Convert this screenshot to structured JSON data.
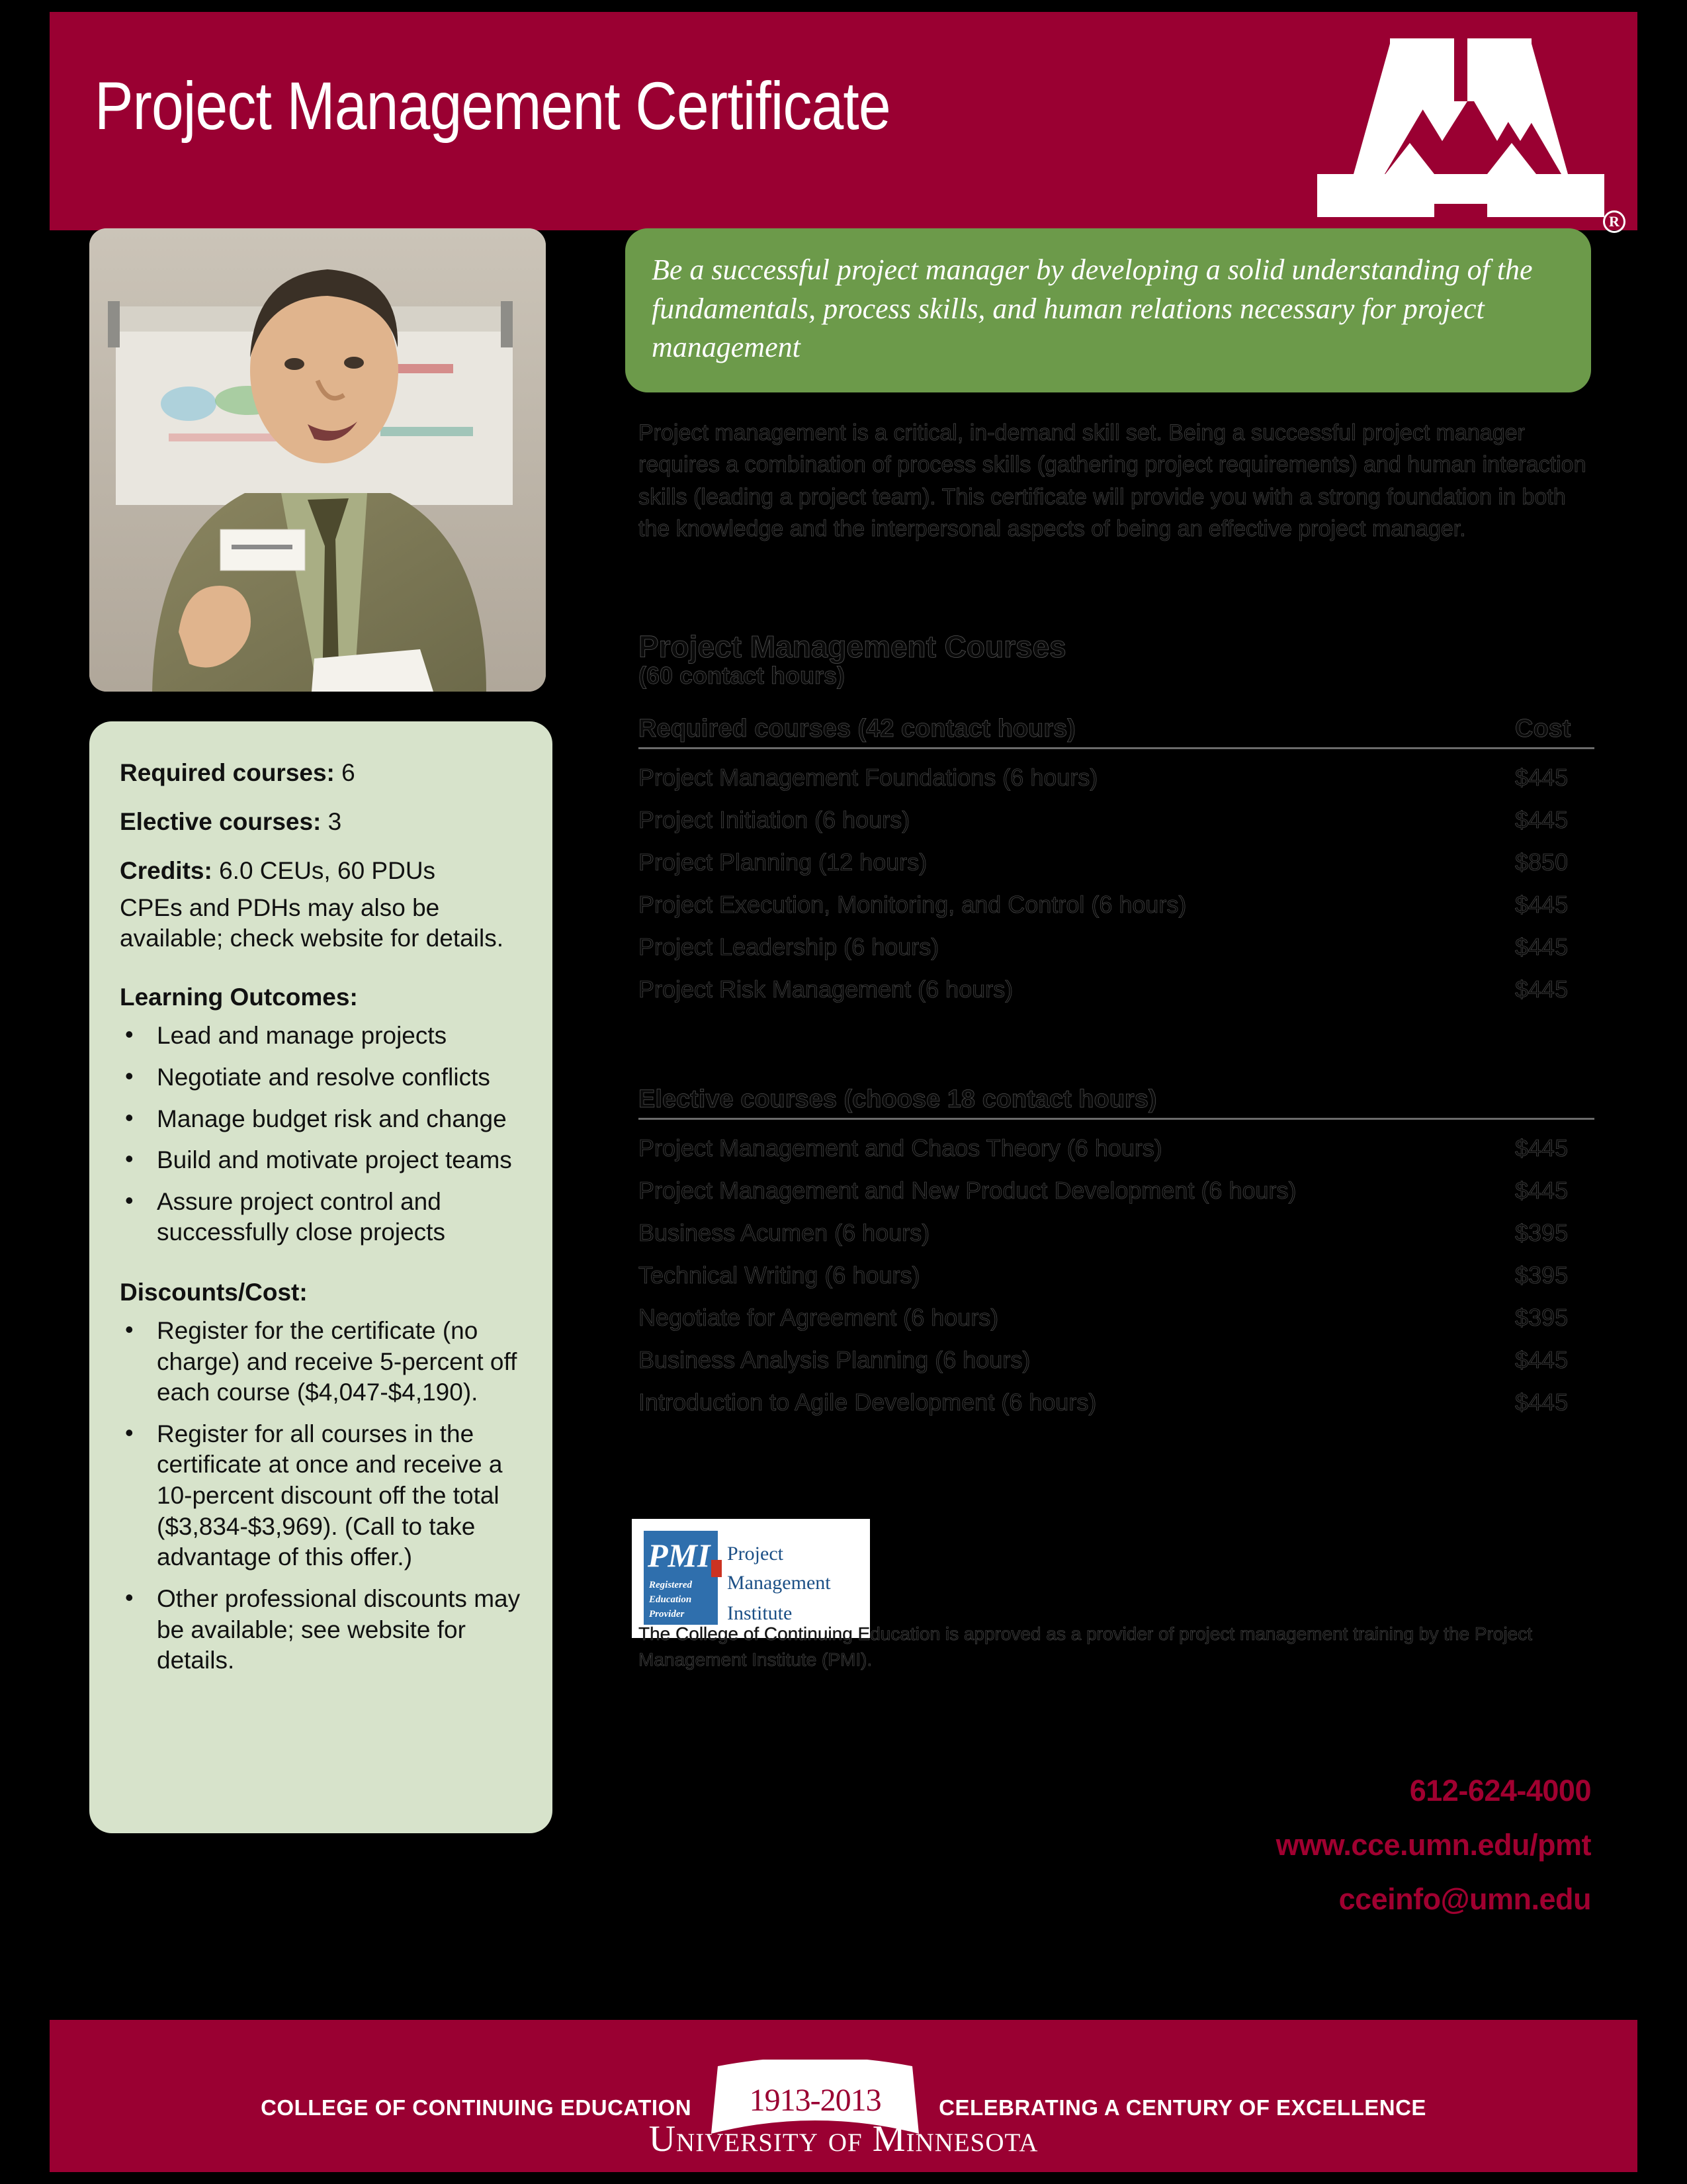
{
  "header": {
    "title": "Project Management Certificate",
    "logo_name": "umn-block-m-logo",
    "registered_mark": "R"
  },
  "photo": {
    "alt": "Instructor presenting in front of a flip chart"
  },
  "quote": {
    "text": "Be a successful project manager by developing a solid understanding of the fundamentals, process skills, and human relations necessary for project management"
  },
  "intro": {
    "paragraph": "Project management is a critical, in-demand skill set. Being a successful project manager requires a combination of process skills (gathering project requirements) and human interaction skills (leading a project team). This certificate will provide you with a strong foundation in both the knowledge and the interpersonal aspects of being an effective project manager."
  },
  "courses": {
    "title": "Project Management Courses",
    "subtitle": "(60 contact hours)",
    "cost_header": "Cost",
    "required": {
      "header": "Required courses (42 contact hours)",
      "rows": [
        {
          "name": "Project Management Foundations (6 hours)",
          "cost": "$445"
        },
        {
          "name": "Project Initiation (6 hours)",
          "cost": "$445"
        },
        {
          "name": "Project Planning (12 hours)",
          "cost": "$850"
        },
        {
          "name": "Project Execution, Monitoring, and Control (6 hours)",
          "cost": "$445"
        },
        {
          "name": "Project Leadership (6 hours)",
          "cost": "$445"
        },
        {
          "name": "Project Risk Management (6 hours)",
          "cost": "$445"
        }
      ]
    },
    "elective": {
      "header": "Elective courses (choose 18 contact hours)",
      "rows": [
        {
          "name": "Project Management and Chaos Theory (6 hours)",
          "cost": "$445"
        },
        {
          "name": "Project Management and New Product Development (6 hours)",
          "cost": "$445"
        },
        {
          "name": "Business Acumen (6 hours)",
          "cost": "$395"
        },
        {
          "name": "Technical Writing (6 hours)",
          "cost": "$395"
        },
        {
          "name": "Negotiate for Agreement (6 hours)",
          "cost": "$395"
        },
        {
          "name": "Business Analysis Planning (6 hours)",
          "cost": "$445"
        },
        {
          "name": "Introduction to Agile Development (6 hours)",
          "cost": "$445"
        }
      ]
    }
  },
  "sidebar": {
    "required_label": "Required courses:",
    "required_value": "6",
    "elective_label": "Elective courses:",
    "elective_value": "3",
    "credits_label": "Credits:",
    "credits_value": "6.0 CEUs, 60 PDUs",
    "credits_note": "CPEs and PDHs may also be available; check website for details.",
    "outcomes_heading": "Learning Outcomes:",
    "outcomes": [
      "Lead and manage projects",
      "Negotiate and resolve conflicts",
      "Manage budget risk and change",
      "Build and motivate project teams",
      "Assure project control and successfully close projects"
    ],
    "discounts_heading": "Discounts/Cost:",
    "discounts": [
      "Register for the certificate (no charge) and receive 5-percent off each course ($4,047-$4,190).",
      "Register for all courses in the certificate at once and receive a 10-percent discount off the total ($3,834-$3,969). (Call to take advantage of this offer.)",
      "Other professional discounts may be available; see website for details."
    ]
  },
  "pmi": {
    "logo_name": "pmi-registered-education-provider-logo",
    "logo_word_1": "Project",
    "logo_word_2": "Management",
    "logo_word_3": "Institute",
    "logo_badge_1": "Registered",
    "logo_badge_2": "Education",
    "logo_badge_3": "Provider",
    "caption": "The College of Continuing Education is approved as a provider of project management training by the Project Management Institute (PMI)."
  },
  "contact": {
    "phone": "612-624-4000",
    "website": "www.cce.umn.edu/pmt",
    "email": "cceinfo@umn.edu"
  },
  "footer": {
    "left_text": "COLLEGE OF CONTINUING EDUCATION",
    "ribbon_years": "1913-2013",
    "right_text": "CELEBRATING A CENTURY OF EXCELLENCE",
    "university": "University of Minnesota"
  },
  "colors": {
    "maroon": "#9a0032",
    "contact_maroon": "#a00030",
    "quote_green": "#6c9a4a",
    "sidebar_green": "#d7e3cb",
    "background": "#000000"
  }
}
